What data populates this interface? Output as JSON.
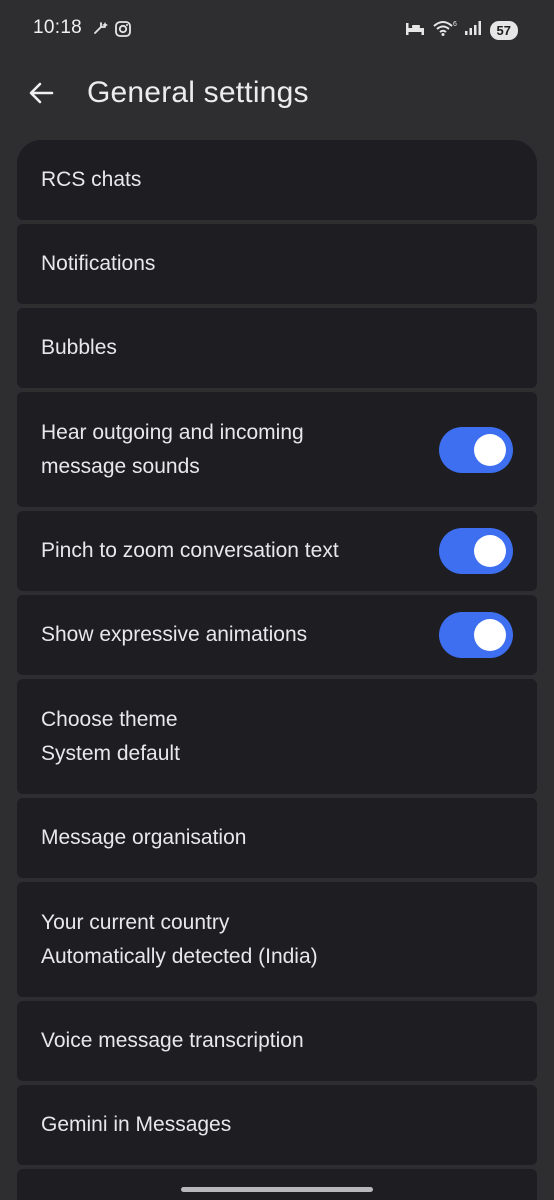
{
  "status_bar": {
    "time": "10:18",
    "battery": "57",
    "left_icons": [
      "spark-icon",
      "instagram-icon"
    ],
    "right_icons": [
      "sleep-icon",
      "wifi-icon",
      "signal-icon"
    ]
  },
  "header": {
    "title": "General settings",
    "back_icon": "arrow-left-icon"
  },
  "settings": [
    {
      "label": "RCS chats"
    },
    {
      "label": "Notifications"
    },
    {
      "label": "Bubbles"
    },
    {
      "label": "Hear outgoing and incoming",
      "label2": "message sounds",
      "toggle": true
    },
    {
      "label": "Pinch to zoom conversation text",
      "toggle": true
    },
    {
      "label": "Show expressive animations",
      "toggle": true
    },
    {
      "label": "Choose theme",
      "label2": "System default"
    },
    {
      "label": "Message organisation"
    },
    {
      "label": "Your current country",
      "label2": "Automatically detected (India)"
    },
    {
      "label": "Voice message transcription"
    },
    {
      "label": "Gemini in Messages"
    }
  ],
  "colors": {
    "background": "#2e2e30",
    "row_background": "#1d1d22",
    "toggle_on": "#3d6ff0"
  }
}
